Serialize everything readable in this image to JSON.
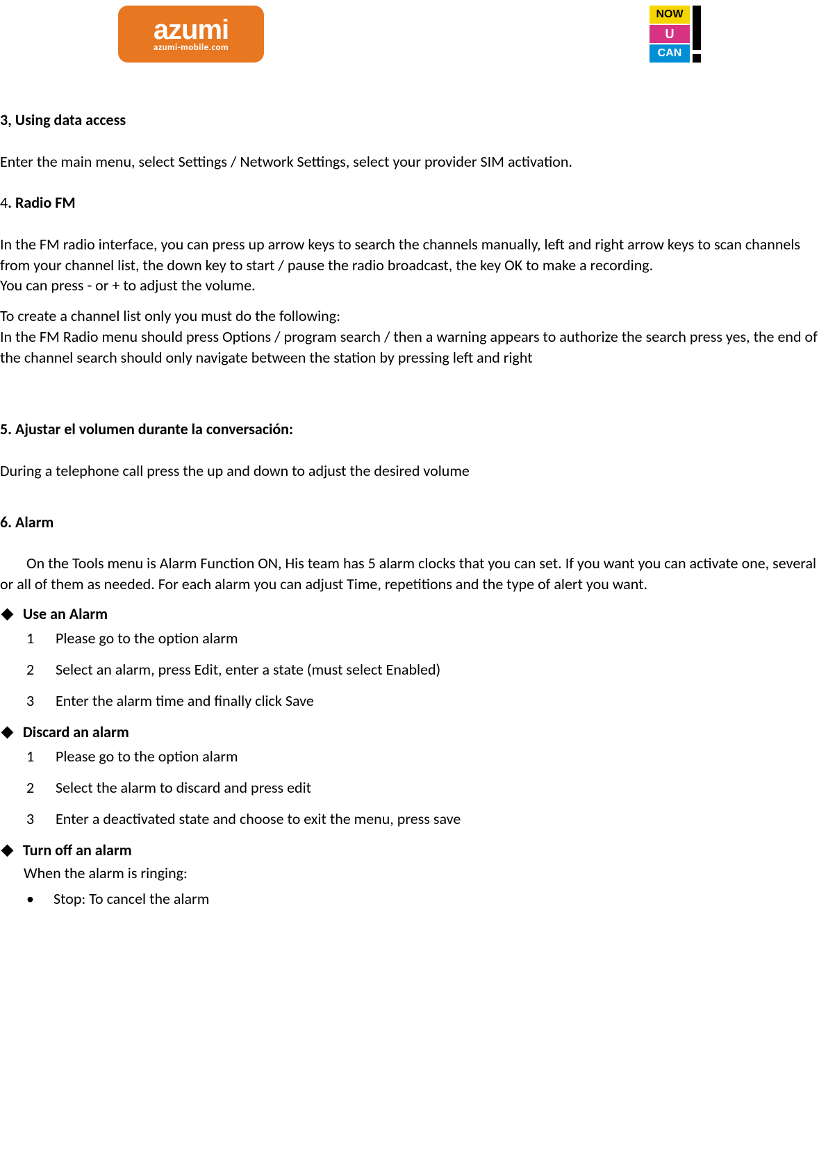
{
  "logo": {
    "brand": "azumi",
    "url_text": "azumi-mobile.com"
  },
  "tagline": {
    "line1": "NOW",
    "line2": "U",
    "line3": "CAN"
  },
  "sections": {
    "s3": {
      "heading": "3, Using data access",
      "body": "Enter the main menu, select Settings / Network Settings, select your provider SIM activation."
    },
    "s4": {
      "num": "4",
      "heading_rest": ". Radio FM",
      "p1": "In the FM radio interface, you can press up arrow keys to search the channels manually, left and right arrow keys to scan channels from your channel list, the down key to start / pause the radio broadcast, the key OK to make a recording.",
      "p2": "You can press - or + to adjust the volume.",
      "p3": "To create a channel list only you must do the following:",
      "p4": "In the FM Radio menu should press Options / program search / then a warning appears to authorize the search press yes, the end of the channel search should only navigate between the station by pressing left and right"
    },
    "s5": {
      "heading": "5. Ajustar el volumen durante la conversación:",
      "body": "During a telephone call press the up and down to adjust the desired volume"
    },
    "s6": {
      "heading": "6. Alarm",
      "intro": "On the Tools menu is Alarm Function ON, His team has 5 alarm clocks that you can set. If you want you can activate one, several or all of them as needed. For each alarm you can adjust Time, repetitions and the type of alert you want.",
      "use": {
        "title": "Use an Alarm",
        "i1": "Please go to the option alarm",
        "i2": "Select an alarm, press Edit, enter a state (must select Enabled)",
        "i3": "Enter the alarm time and finally click Save"
      },
      "discard": {
        "title": "Discard an alarm",
        "i1": "Please go to the option alarm",
        "i2": "Select the alarm to discard and press edit",
        "i3": "Enter a deactivated state and choose to exit the menu, press save"
      },
      "turnoff": {
        "title": "Turn off an alarm",
        "sub": "When the alarm is ringing:",
        "b1": "Stop: To cancel the alarm"
      }
    }
  },
  "labels": {
    "n1": "1",
    "n2": "2",
    "n3": "3",
    "dot": "•",
    "diamond": "◆"
  }
}
